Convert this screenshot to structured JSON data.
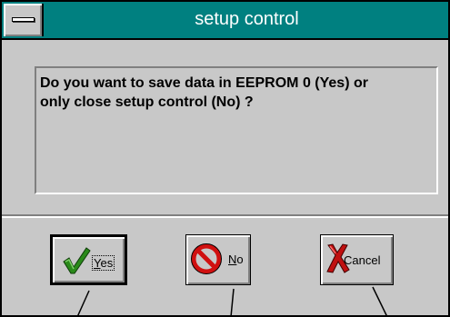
{
  "window": {
    "title": "setup control"
  },
  "message": {
    "line1": "Do you want to save data in EEPROM 0 (Yes) or",
    "line2": "only close setup control (No) ?"
  },
  "buttons": {
    "yes": {
      "mnemonic": "Y",
      "rest": "es",
      "icon": "checkmark-icon"
    },
    "no": {
      "mnemonic": "N",
      "rest": "o",
      "icon": "prohibited-icon"
    },
    "cancel": {
      "label": "Cancel",
      "icon": "red-x-icon"
    }
  },
  "colors": {
    "titlebar": "#008080",
    "face": "#c8c8c8",
    "check": "#2a8a1a",
    "stop": "#d01010",
    "xmark": "#c01010"
  }
}
